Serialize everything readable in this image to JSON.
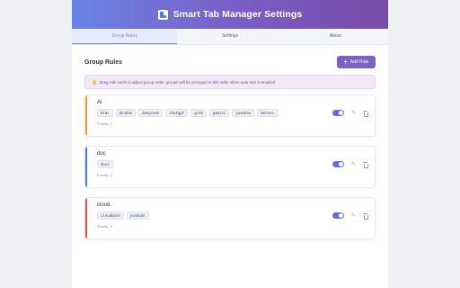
{
  "header": {
    "title": "Smart Tab Manager Settings"
  },
  "tabs": [
    {
      "label": "Group Rules"
    },
    {
      "label": "Settings"
    },
    {
      "label": "About"
    }
  ],
  "section": {
    "title": "Group Rules",
    "add_label": "Add Rule"
  },
  "info": {
    "text": "Drag rule cards to adjust group order, groups will be arranged in this order when auto-sort is enabled"
  },
  "colors": {
    "accent": "#7a61c9",
    "stripe_ai": "#e8a33a",
    "stripe_doc": "#4a7be6",
    "stripe_cloud": "#e05252"
  },
  "rules": [
    {
      "name": "AI",
      "keywords": [
        "kimi",
        "doubao",
        "deepseek",
        "chatgpt",
        "grok",
        "gemini",
        "yuanbao",
        "metaso"
      ],
      "priority": "Priority: 1",
      "enabled": true
    },
    {
      "name": "doc",
      "keywords": [
        "docs"
      ],
      "priority": "Priority: 2",
      "enabled": true
    },
    {
      "name": "cloud",
      "keywords": [
        "cloudbase",
        "yunduan"
      ],
      "priority": "Priority: 3",
      "enabled": true
    }
  ]
}
